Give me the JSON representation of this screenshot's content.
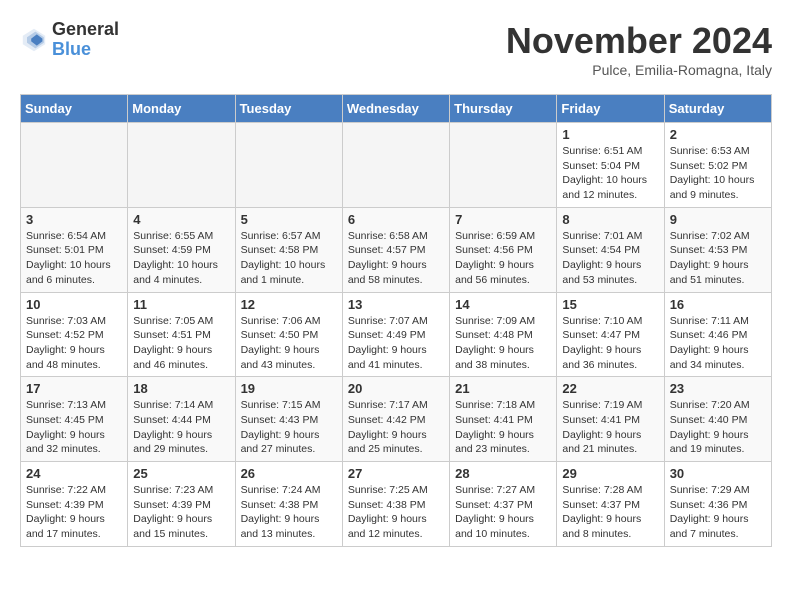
{
  "logo": {
    "general": "General",
    "blue": "Blue"
  },
  "title": "November 2024",
  "location": "Pulce, Emilia-Romagna, Italy",
  "days_of_week": [
    "Sunday",
    "Monday",
    "Tuesday",
    "Wednesday",
    "Thursday",
    "Friday",
    "Saturday"
  ],
  "weeks": [
    [
      {
        "day": "",
        "info": ""
      },
      {
        "day": "",
        "info": ""
      },
      {
        "day": "",
        "info": ""
      },
      {
        "day": "",
        "info": ""
      },
      {
        "day": "",
        "info": ""
      },
      {
        "day": "1",
        "info": "Sunrise: 6:51 AM\nSunset: 5:04 PM\nDaylight: 10 hours and 12 minutes."
      },
      {
        "day": "2",
        "info": "Sunrise: 6:53 AM\nSunset: 5:02 PM\nDaylight: 10 hours and 9 minutes."
      }
    ],
    [
      {
        "day": "3",
        "info": "Sunrise: 6:54 AM\nSunset: 5:01 PM\nDaylight: 10 hours and 6 minutes."
      },
      {
        "day": "4",
        "info": "Sunrise: 6:55 AM\nSunset: 4:59 PM\nDaylight: 10 hours and 4 minutes."
      },
      {
        "day": "5",
        "info": "Sunrise: 6:57 AM\nSunset: 4:58 PM\nDaylight: 10 hours and 1 minute."
      },
      {
        "day": "6",
        "info": "Sunrise: 6:58 AM\nSunset: 4:57 PM\nDaylight: 9 hours and 58 minutes."
      },
      {
        "day": "7",
        "info": "Sunrise: 6:59 AM\nSunset: 4:56 PM\nDaylight: 9 hours and 56 minutes."
      },
      {
        "day": "8",
        "info": "Sunrise: 7:01 AM\nSunset: 4:54 PM\nDaylight: 9 hours and 53 minutes."
      },
      {
        "day": "9",
        "info": "Sunrise: 7:02 AM\nSunset: 4:53 PM\nDaylight: 9 hours and 51 minutes."
      }
    ],
    [
      {
        "day": "10",
        "info": "Sunrise: 7:03 AM\nSunset: 4:52 PM\nDaylight: 9 hours and 48 minutes."
      },
      {
        "day": "11",
        "info": "Sunrise: 7:05 AM\nSunset: 4:51 PM\nDaylight: 9 hours and 46 minutes."
      },
      {
        "day": "12",
        "info": "Sunrise: 7:06 AM\nSunset: 4:50 PM\nDaylight: 9 hours and 43 minutes."
      },
      {
        "day": "13",
        "info": "Sunrise: 7:07 AM\nSunset: 4:49 PM\nDaylight: 9 hours and 41 minutes."
      },
      {
        "day": "14",
        "info": "Sunrise: 7:09 AM\nSunset: 4:48 PM\nDaylight: 9 hours and 38 minutes."
      },
      {
        "day": "15",
        "info": "Sunrise: 7:10 AM\nSunset: 4:47 PM\nDaylight: 9 hours and 36 minutes."
      },
      {
        "day": "16",
        "info": "Sunrise: 7:11 AM\nSunset: 4:46 PM\nDaylight: 9 hours and 34 minutes."
      }
    ],
    [
      {
        "day": "17",
        "info": "Sunrise: 7:13 AM\nSunset: 4:45 PM\nDaylight: 9 hours and 32 minutes."
      },
      {
        "day": "18",
        "info": "Sunrise: 7:14 AM\nSunset: 4:44 PM\nDaylight: 9 hours and 29 minutes."
      },
      {
        "day": "19",
        "info": "Sunrise: 7:15 AM\nSunset: 4:43 PM\nDaylight: 9 hours and 27 minutes."
      },
      {
        "day": "20",
        "info": "Sunrise: 7:17 AM\nSunset: 4:42 PM\nDaylight: 9 hours and 25 minutes."
      },
      {
        "day": "21",
        "info": "Sunrise: 7:18 AM\nSunset: 4:41 PM\nDaylight: 9 hours and 23 minutes."
      },
      {
        "day": "22",
        "info": "Sunrise: 7:19 AM\nSunset: 4:41 PM\nDaylight: 9 hours and 21 minutes."
      },
      {
        "day": "23",
        "info": "Sunrise: 7:20 AM\nSunset: 4:40 PM\nDaylight: 9 hours and 19 minutes."
      }
    ],
    [
      {
        "day": "24",
        "info": "Sunrise: 7:22 AM\nSunset: 4:39 PM\nDaylight: 9 hours and 17 minutes."
      },
      {
        "day": "25",
        "info": "Sunrise: 7:23 AM\nSunset: 4:39 PM\nDaylight: 9 hours and 15 minutes."
      },
      {
        "day": "26",
        "info": "Sunrise: 7:24 AM\nSunset: 4:38 PM\nDaylight: 9 hours and 13 minutes."
      },
      {
        "day": "27",
        "info": "Sunrise: 7:25 AM\nSunset: 4:38 PM\nDaylight: 9 hours and 12 minutes."
      },
      {
        "day": "28",
        "info": "Sunrise: 7:27 AM\nSunset: 4:37 PM\nDaylight: 9 hours and 10 minutes."
      },
      {
        "day": "29",
        "info": "Sunrise: 7:28 AM\nSunset: 4:37 PM\nDaylight: 9 hours and 8 minutes."
      },
      {
        "day": "30",
        "info": "Sunrise: 7:29 AM\nSunset: 4:36 PM\nDaylight: 9 hours and 7 minutes."
      }
    ]
  ]
}
